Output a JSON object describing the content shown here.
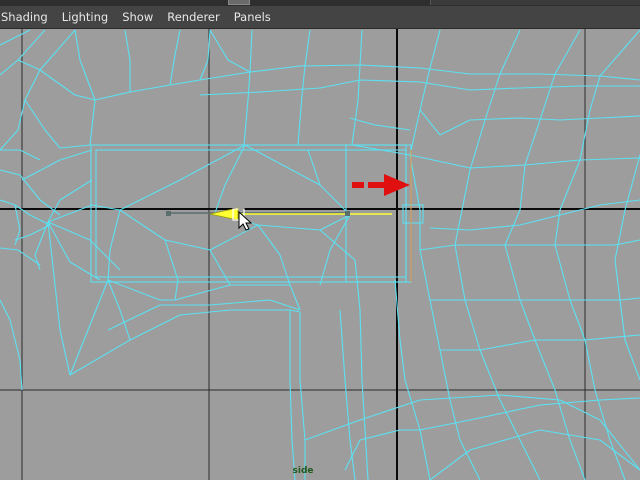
{
  "menubar": {
    "items": [
      {
        "label": "Shading"
      },
      {
        "label": "Lighting"
      },
      {
        "label": "Show"
      },
      {
        "label": "Renderer"
      },
      {
        "label": "Panels"
      }
    ]
  },
  "viewport": {
    "camera_label": "side"
  },
  "colors": {
    "wireframe": "#5ce1f2",
    "grid": "#2a2a2a",
    "axis": "#0a0a0a",
    "viewport_bg": "#9d9d9d",
    "manipulator": "#ffff33",
    "annotation_arrow": "#e01010",
    "camera_label": "#1f5a1f"
  },
  "icons": [
    "mouse-cursor-icon",
    "red-arrow-annotation-icon"
  ]
}
